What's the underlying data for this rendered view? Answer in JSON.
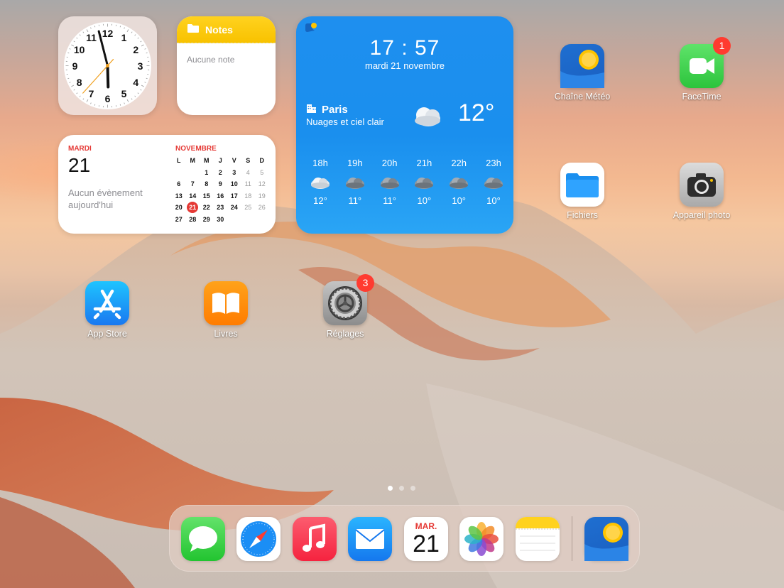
{
  "clock": {
    "numbers": [
      "12",
      "1",
      "2",
      "3",
      "4",
      "5",
      "6",
      "7",
      "8",
      "9",
      "10",
      "11"
    ],
    "hour": 17,
    "minute": 57,
    "second": 37
  },
  "notes": {
    "title": "Notes",
    "empty_text": "Aucune note"
  },
  "calendar": {
    "day_label": "MARDI",
    "day_number": "21",
    "no_event_line1": "Aucun évènement",
    "no_event_line2": "aujourd'hui",
    "month": "NOVEMBRE",
    "weekdays": [
      "L",
      "M",
      "M",
      "J",
      "V",
      "S",
      "D"
    ],
    "weeks": [
      [
        "",
        "",
        "1",
        "2",
        "3",
        "4",
        "5"
      ],
      [
        "6",
        "7",
        "8",
        "9",
        "10",
        "11",
        "12"
      ],
      [
        "13",
        "14",
        "15",
        "16",
        "17",
        "18",
        "19"
      ],
      [
        "20",
        "21",
        "22",
        "23",
        "24",
        "25",
        "26"
      ],
      [
        "27",
        "28",
        "29",
        "30",
        "",
        "",
        ""
      ]
    ],
    "today": "21"
  },
  "weather": {
    "time": "17 : 57",
    "date": "mardi 21 novembre",
    "city": "Paris",
    "condition": "Nuages et ciel clair",
    "temperature": "12°",
    "hourly": [
      {
        "hour": "18h",
        "temp": "12°",
        "icon": "partly-cloudy-icon"
      },
      {
        "hour": "19h",
        "temp": "11°",
        "icon": "cloud-icon"
      },
      {
        "hour": "20h",
        "temp": "11°",
        "icon": "cloud-icon"
      },
      {
        "hour": "21h",
        "temp": "10°",
        "icon": "cloud-icon"
      },
      {
        "hour": "22h",
        "temp": "10°",
        "icon": "cloud-icon"
      },
      {
        "hour": "23h",
        "temp": "10°",
        "icon": "cloud-icon"
      }
    ]
  },
  "apps": {
    "chaine_meteo": {
      "label": "Chaîne Météo"
    },
    "facetime": {
      "label": "FaceTime",
      "badge": "1"
    },
    "fichiers": {
      "label": "Fichiers"
    },
    "appareil_photo": {
      "label": "Appareil photo"
    },
    "app_store": {
      "label": "App Store"
    },
    "livres": {
      "label": "Livres"
    },
    "reglages": {
      "label": "Réglages",
      "badge": "3"
    }
  },
  "dock": {
    "calendar_month": "MAR.",
    "calendar_day": "21",
    "items": [
      "messages-icon",
      "safari-icon",
      "music-icon",
      "mail-icon",
      "calendar-icon",
      "photos-icon",
      "notes-icon",
      "chaine-meteo-icon"
    ]
  },
  "page_dots": {
    "count": 3,
    "active": 0
  },
  "colors": {
    "weather_blue": "#1e8fef",
    "calendar_red": "#e53935",
    "badge_red": "#ff3b30",
    "notes_yellow": "#ffd21f"
  }
}
